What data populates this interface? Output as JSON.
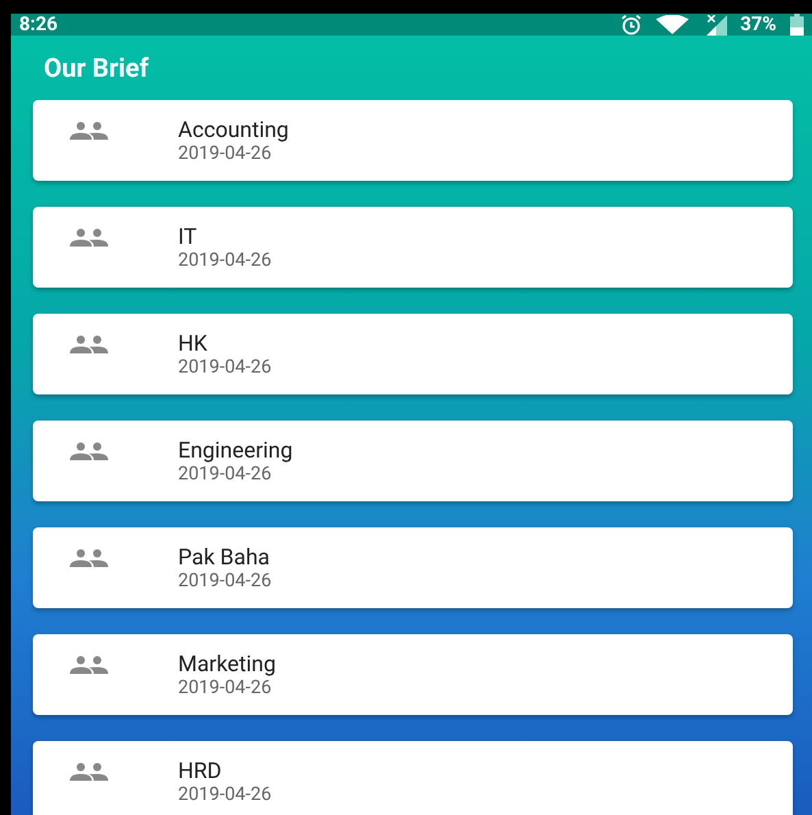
{
  "status_bar": {
    "time": "8:26",
    "battery": "37%"
  },
  "app_bar": {
    "title": "Our Brief"
  },
  "items": [
    {
      "name": "Accounting",
      "date": "2019-04-26"
    },
    {
      "name": "IT",
      "date": "2019-04-26"
    },
    {
      "name": "HK",
      "date": "2019-04-26"
    },
    {
      "name": "Engineering",
      "date": "2019-04-26"
    },
    {
      "name": "Pak Baha",
      "date": "2019-04-26"
    },
    {
      "name": "Marketing",
      "date": "2019-04-26"
    },
    {
      "name": "HRD",
      "date": "2019-04-26"
    }
  ]
}
